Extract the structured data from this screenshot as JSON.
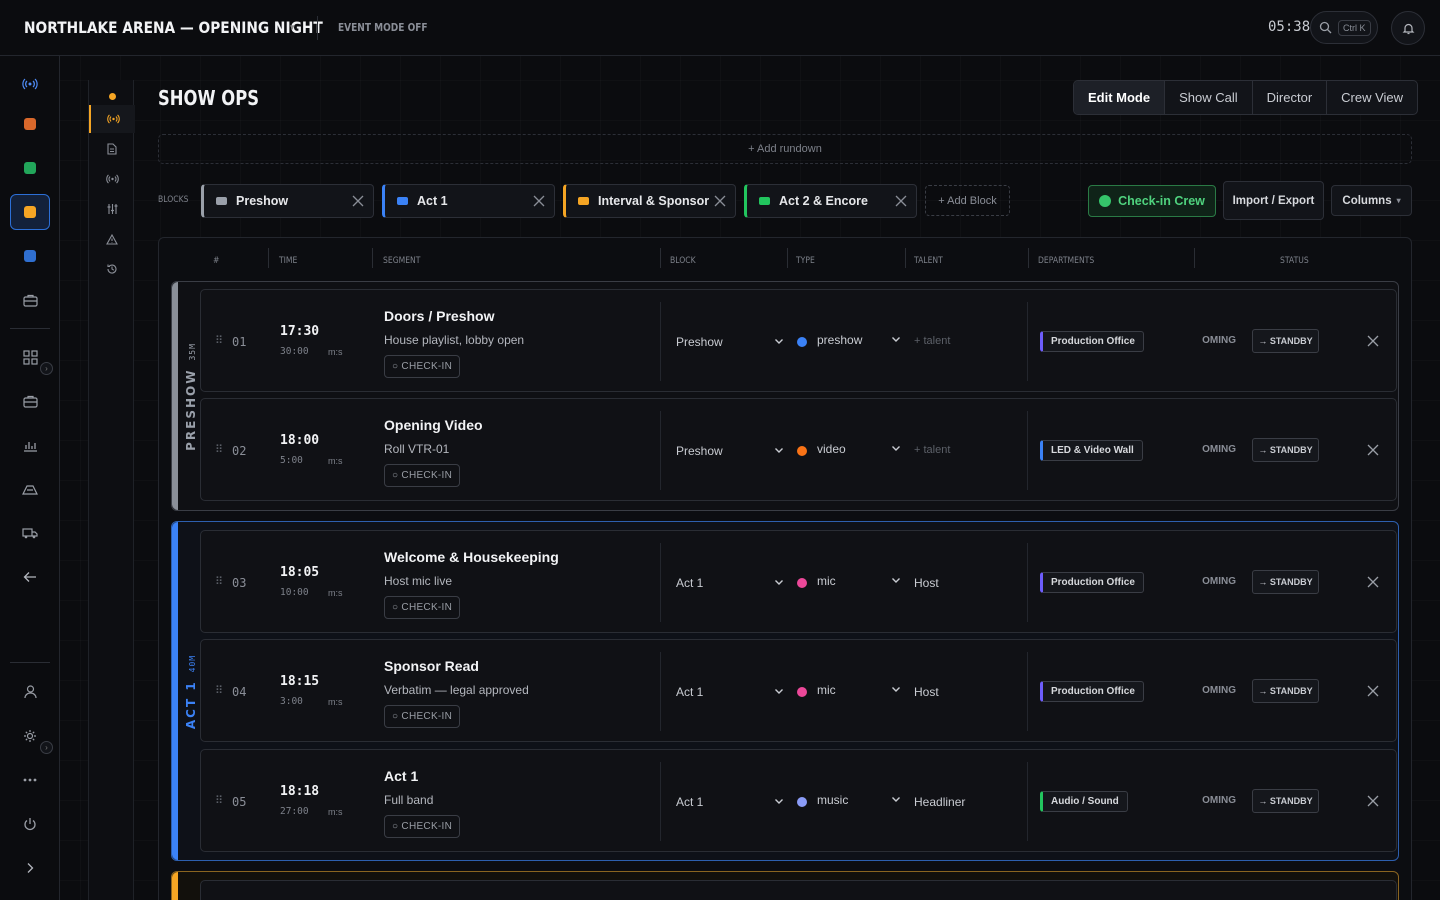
{
  "header": {
    "title": "NORTHLAKE ARENA — OPENING NIGHT",
    "title_caret": "▾",
    "event_mode": "EVENT MODE OFF",
    "clock": "05:38",
    "search_shortcut": "Ctrl K"
  },
  "page": {
    "title": "SHOW OPS",
    "add_rundown": "+ Add rundown",
    "blocks_label": "BLOCKS",
    "add_block": "+ Add Block",
    "checkin_crew": "Check-in Crew",
    "import_export": "Import / Export",
    "columns": "Columns",
    "columns_caret": "▾"
  },
  "mode_tabs": [
    {
      "label": "Edit Mode",
      "active": true
    },
    {
      "label": "Show Call",
      "active": false
    },
    {
      "label": "Director",
      "active": false
    },
    {
      "label": "Crew View",
      "active": false
    }
  ],
  "block_chips": [
    {
      "label": "Preshow",
      "color": "#9aa0aa"
    },
    {
      "label": "Act 1",
      "color": "#3b82f6"
    },
    {
      "label": "Interval & Sponsor",
      "color": "#f5a524"
    },
    {
      "label": "Act 2 & Encore",
      "color": "#22c55e"
    }
  ],
  "table_headers": {
    "num": "#",
    "time": "TIME",
    "segment": "SEGMENT",
    "block": "BLOCK",
    "type": "TYPE",
    "talent": "TALENT",
    "departments": "DEPARTMENTS",
    "status": "STATUS"
  },
  "groups": [
    {
      "name": "PRESHOW",
      "duration": "35M",
      "color": "#8a8f98"
    },
    {
      "name": "ACT 1",
      "duration": "40M",
      "color": "#3b82f6"
    },
    {
      "color": "#f5a524"
    }
  ],
  "rows": [
    {
      "num": "01",
      "time": "17:30",
      "dur": "30:00",
      "unit": "m:s",
      "title": "Doors / Preshow",
      "subtitle": "House playlist, lobby open",
      "checkin": "○ CHECK-IN",
      "block": "Preshow",
      "type": "preshow",
      "type_color": "#3b82f6",
      "talent": "+ talent",
      "talent_empty": true,
      "dept": "Production Office",
      "dept_color": "#6d5dfc",
      "status": "UPCOMING",
      "standby": "→ STANDBY"
    },
    {
      "num": "02",
      "time": "18:00",
      "dur": "5:00",
      "unit": "m:s",
      "title": "Opening Video",
      "subtitle": "Roll VTR-01",
      "checkin": "○ CHECK-IN",
      "block": "Preshow",
      "type": "video",
      "type_color": "#f97316",
      "talent": "+ talent",
      "talent_empty": true,
      "dept": "LED & Video Wall",
      "dept_color": "#3b82f6",
      "status": "UPCOMING",
      "standby": "→ STANDBY"
    },
    {
      "num": "03",
      "time": "18:05",
      "dur": "10:00",
      "unit": "m:s",
      "title": "Welcome & Housekeeping",
      "subtitle": "Host mic live",
      "checkin": "○ CHECK-IN",
      "block": "Act 1",
      "type": "mic",
      "type_color": "#ec4899",
      "talent": "Host",
      "talent_empty": false,
      "dept": "Production Office",
      "dept_color": "#6d5dfc",
      "status": "UPCOMING",
      "standby": "→ STANDBY"
    },
    {
      "num": "04",
      "time": "18:15",
      "dur": "3:00",
      "unit": "m:s",
      "title": "Sponsor Read",
      "subtitle": "Verbatim — legal approved",
      "checkin": "○ CHECK-IN",
      "block": "Act 1",
      "type": "mic",
      "type_color": "#ec4899",
      "talent": "Host",
      "talent_empty": false,
      "dept": "Production Office",
      "dept_color": "#6d5dfc",
      "status": "UPCOMING",
      "standby": "→ STANDBY"
    },
    {
      "num": "05",
      "time": "18:18",
      "dur": "27:00",
      "unit": "m:s",
      "title": "Act 1",
      "subtitle": "Full band",
      "checkin": "○ CHECK-IN",
      "block": "Act 1",
      "type": "music",
      "type_color": "#8b9cf7",
      "talent": "Headliner",
      "talent_empty": false,
      "dept": "Audio / Sound",
      "dept_color": "#22c55e",
      "status": "UPCOMING",
      "standby": "→ STANDBY"
    }
  ]
}
